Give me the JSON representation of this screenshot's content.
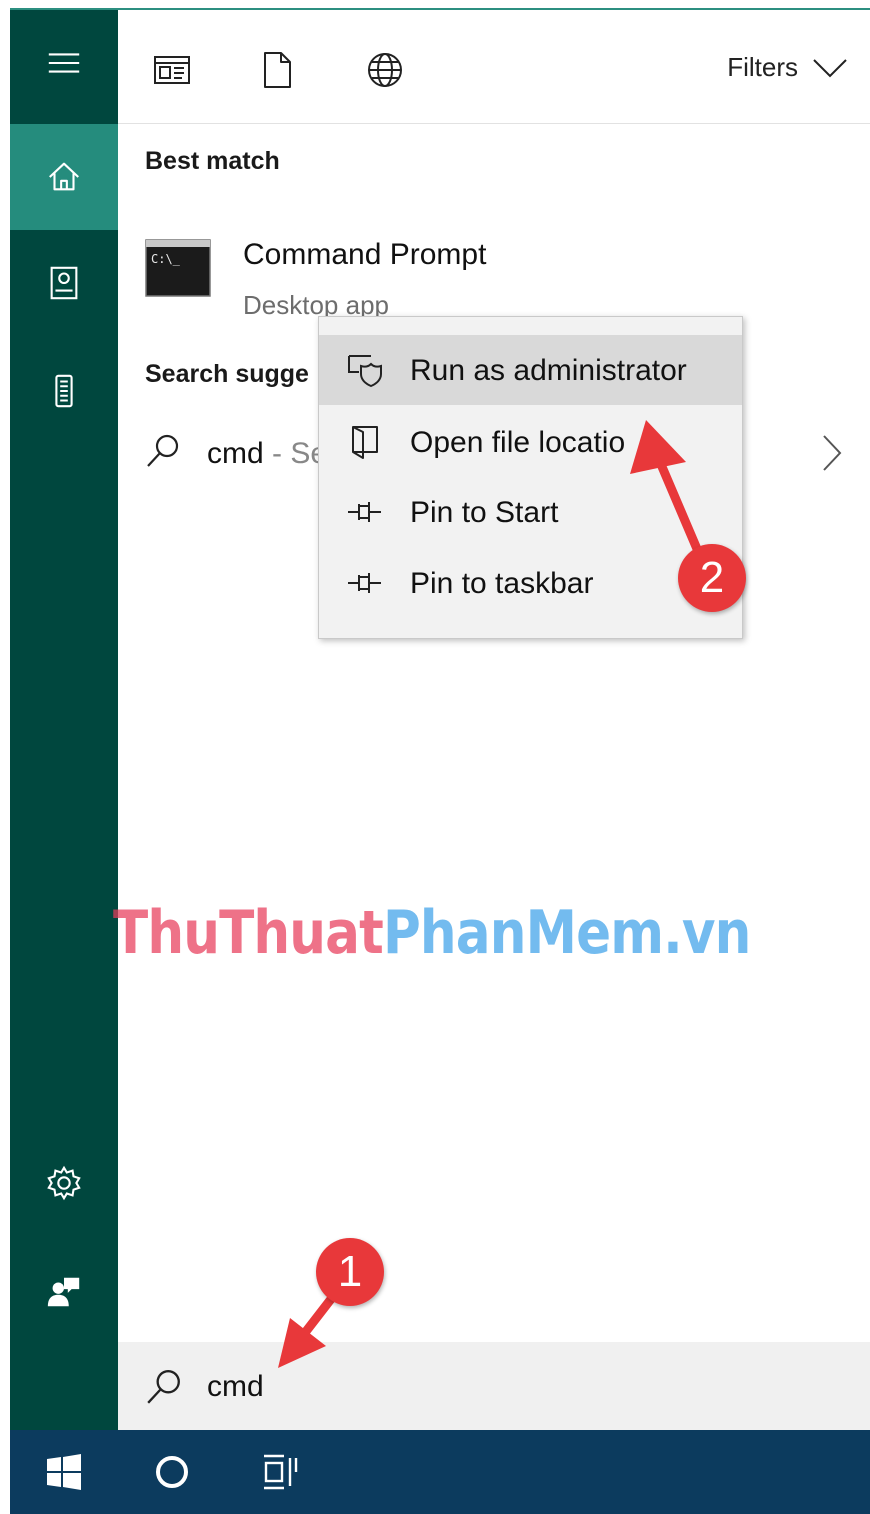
{
  "toolbar": {
    "filters_label": "Filters",
    "icons": [
      "apps-icon",
      "documents-icon",
      "web-icon"
    ]
  },
  "rail": {
    "items": [
      "menu-icon",
      "home-icon",
      "notebook-icon",
      "devices-icon",
      "settings-icon",
      "feedback-icon"
    ],
    "active": "home-icon"
  },
  "results": {
    "best_match_title": "Best match",
    "best_match": {
      "name": "Command Prompt",
      "kind": "Desktop app",
      "icon": "command-prompt-icon",
      "icon_text": "C:\\_"
    },
    "suggestions_title": "Search sugge",
    "suggestions": [
      {
        "query": "cmd",
        "suffix": " - Se"
      }
    ]
  },
  "context_menu": {
    "items": [
      {
        "label": "Run as administrator",
        "icon": "admin-shield-icon",
        "highlighted": true
      },
      {
        "label": "Open file locatio",
        "icon": "folder-location-icon",
        "highlighted": false
      },
      {
        "label": "Pin to Start",
        "icon": "pin-icon",
        "highlighted": false
      },
      {
        "label": "Pin to taskbar",
        "icon": "pin-icon",
        "highlighted": false
      }
    ]
  },
  "search": {
    "value": "cmd",
    "icon": "search-icon"
  },
  "taskbar": {
    "items": [
      "windows-start-icon",
      "cortana-circle-icon",
      "task-view-icon"
    ]
  },
  "watermark": {
    "part1": "ThuThuat",
    "part2": "PhanMem.vn"
  },
  "annotations": {
    "step1": "1",
    "step2": "2",
    "color": "#e8383a"
  }
}
